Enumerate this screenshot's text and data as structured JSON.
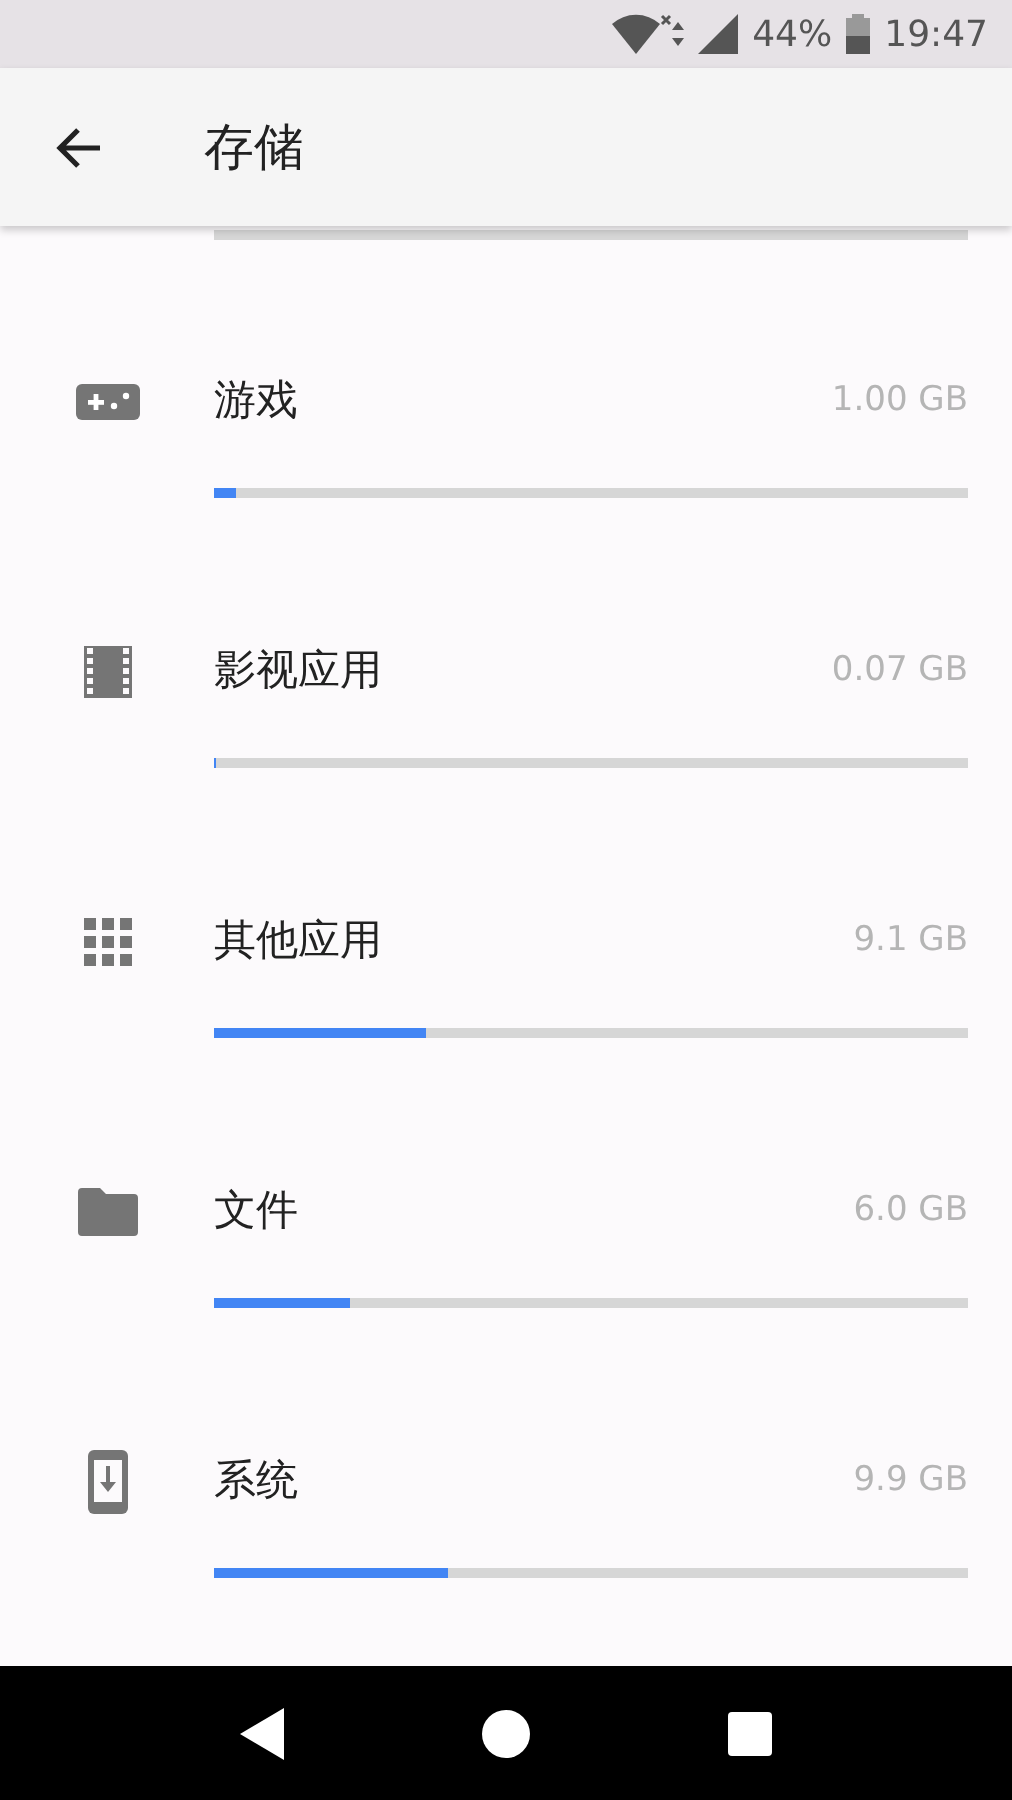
{
  "status_bar": {
    "battery": "44%",
    "time": "19:47"
  },
  "app_bar": {
    "title": "存储"
  },
  "categories": [
    {
      "kind": "games",
      "name": "游戏",
      "size": "1.00 GB",
      "level": 0.03
    },
    {
      "kind": "video",
      "name": "影视应用",
      "size": "0.07 GB",
      "level": 0.003
    },
    {
      "kind": "apps",
      "name": "其他应用",
      "size": "9.1 GB",
      "level": 0.28
    },
    {
      "kind": "files",
      "name": "文件",
      "size": "6.0 GB",
      "level": 0.18
    },
    {
      "kind": "system",
      "name": "系统",
      "size": "9.9 GB",
      "level": 0.31
    }
  ]
}
